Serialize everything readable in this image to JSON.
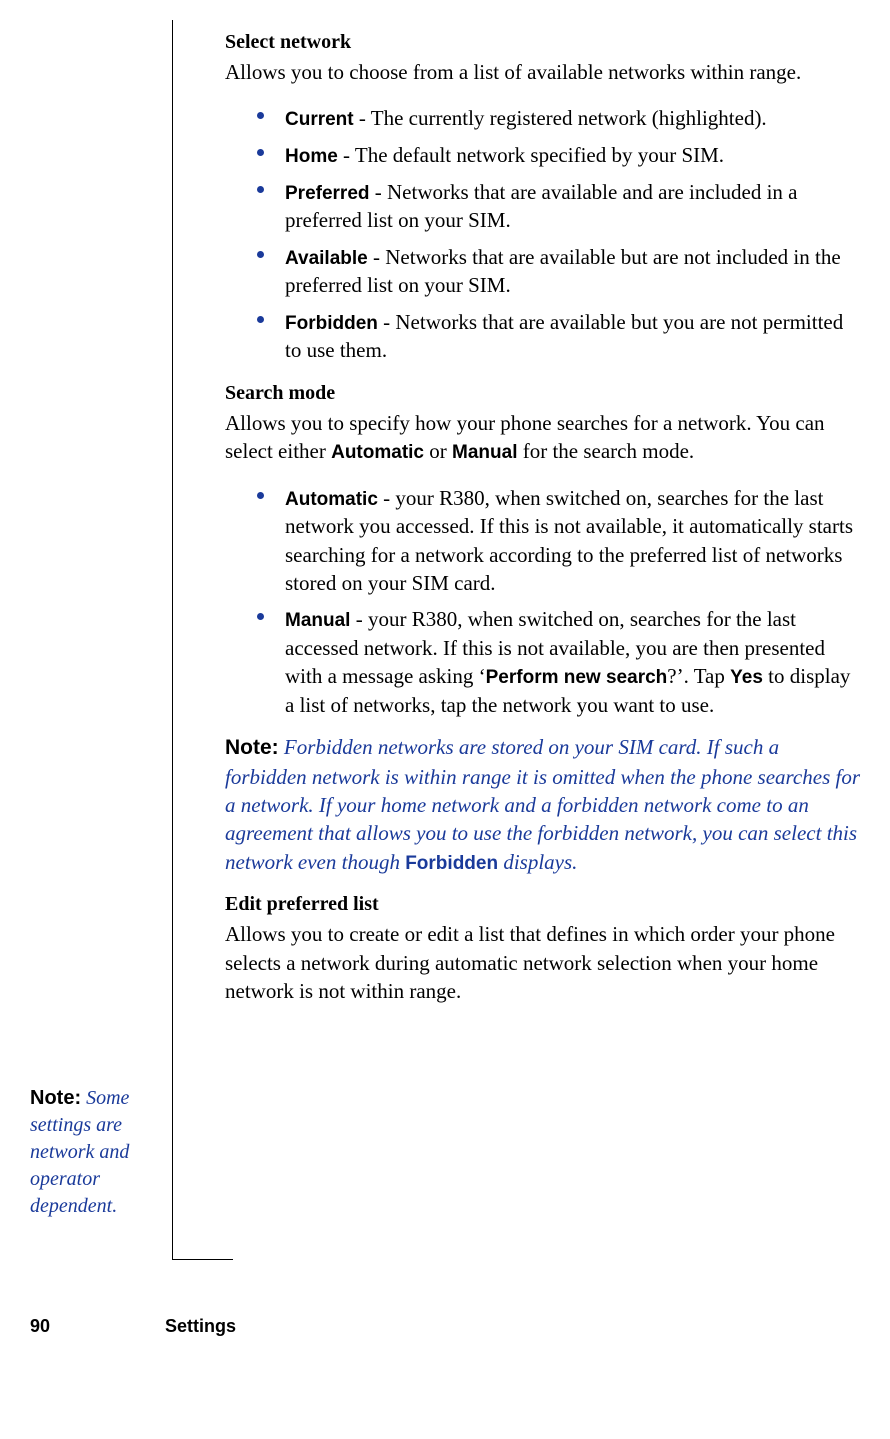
{
  "sections": {
    "select_network": {
      "heading": "Select network",
      "intro": "Allows you to choose from a list of available networks within range.",
      "items": [
        {
          "term": "Current",
          "desc": " - The currently registered network (highlighted)."
        },
        {
          "term": "Home",
          "desc": " - The default network specified by your SIM."
        },
        {
          "term": "Preferred",
          "desc": " - Networks that are available and are included in a preferred list on your SIM."
        },
        {
          "term": "Available",
          "desc": " - Networks that are available but are not included in the preferred list on your SIM."
        },
        {
          "term": "Forbidden",
          "desc": " - Networks that are available but you are not permitted to use them."
        }
      ]
    },
    "search_mode": {
      "heading": "Search mode",
      "intro_pre": "Allows you to specify how your phone searches for a network. You can select either ",
      "intro_opt1": "Automatic",
      "intro_mid": " or ",
      "intro_opt2": "Manual",
      "intro_post": " for the search mode.",
      "items": [
        {
          "term": "Automatic",
          "desc": " - your R380, when switched on, searches for the last network you accessed. If this is not available, it automatically starts searching for a network according to the preferred list of networks stored on your SIM card."
        },
        {
          "term": "Manual",
          "desc_pre": " - your R380, when switched on, searches for the last accessed network. If this is not available, you are then presented with a message asking ‘",
          "prompt": "Perform new search",
          "desc_mid": "?’. Tap ",
          "yes": "Yes",
          "desc_post": " to display a list of networks, tap the network you want to use."
        }
      ]
    },
    "main_note": {
      "label": "Note:",
      "body_pre": "Forbidden networks are stored on your SIM card. If such a forbidden network is within range it is omitted when the phone searches for a network. If your home network and a forbidden network come to an agreement that allows you to use the forbidden network, you can select this network even though ",
      "forbidden": "Forbidden",
      "body_post": " displays."
    },
    "edit_preferred": {
      "heading": "Edit preferred list",
      "intro": "Allows you to create or edit a list that defines in which order your phone selects a network during automatic network selection when your home network is not within range."
    }
  },
  "margin_note": {
    "label": "Note:",
    "body": "Some settings are network and operator dependent."
  },
  "footer": {
    "page_number": "90",
    "section_name": "Settings"
  }
}
